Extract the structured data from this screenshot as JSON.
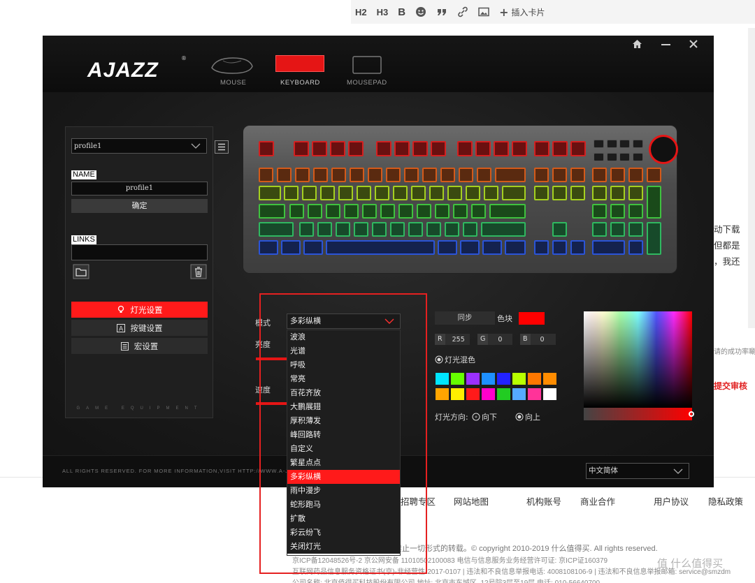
{
  "editor_toolbar": {
    "h2": "H2",
    "h3": "H3",
    "bold": "B",
    "insert_card": "插入卡片"
  },
  "background": {
    "side_lines": [
      "动下载",
      "但都是",
      "，我还"
    ],
    "side_notes": {
      "success": "请的成功率唰",
      "submit": "提交审核"
    },
    "footer_links": [
      "招聘专区",
      "网站地图",
      "机构账号",
      "商业合作",
      "用户协议",
      "隐私政策"
    ],
    "copyright": "禁止一切形式的转载。© copyright 2010-2019 什么值得买. All rights reserved.",
    "icp_line": "京ICP备12048526号-2  京公网安备 11010502100083 电信与信息服务业务经营许可证: 京ICP证160379",
    "drug_line": "互联网药品信息服务资格证书(京)-非经营性-2017-0107 | 违法和不良信息举报电话: 4008108106-9 | 违法和不良信息举报邮箱: service@smzdm",
    "company_line": "公司名称: 北京值得买科技股份有限公司 地址: 北京市东城区..12号院3层至19层 电话: 010-56640700",
    "watermark": "值 什么值得买"
  },
  "app": {
    "brand": "AJAZZ",
    "nav": [
      {
        "label": "MOUSE"
      },
      {
        "label": "KEYBOARD"
      },
      {
        "label": "MOUSEPAD"
      }
    ],
    "footer_text": "ALL RIGHTS RESERVED. FOR MORE INFORMATION,VISIT HTTP://WWW.A-J",
    "language": "中文简体",
    "left_panel": {
      "profile_select": "profile1",
      "name_label": "NAME",
      "name_value": "profile1",
      "confirm": "确定",
      "links_label": "LINKS",
      "menu": [
        {
          "label": "灯光设置",
          "active": true,
          "icon": "bulb-icon"
        },
        {
          "label": "按键设置",
          "active": false,
          "icon": "key-icon"
        },
        {
          "label": "宏设置",
          "active": false,
          "icon": "macro-icon"
        }
      ],
      "tagline": "GAME EQUIPMENT"
    },
    "lighting": {
      "mode_label": "模式",
      "mode_value": "多彩纵横",
      "brightness_label": "亮度",
      "speed_label": "速度",
      "sync": "同步",
      "color_block_label": "色块",
      "current_color": "#ff0000",
      "r_label": "R",
      "r_value": "255",
      "g_label": "G",
      "g_value": "0",
      "b_label": "B",
      "b_value": "0",
      "mix_label": "灯光混色",
      "direction_label": "灯光方向:",
      "dir_down": "向下",
      "dir_up": "向上",
      "palette": [
        "#00e5ff",
        "#66ff00",
        "#9b30ff",
        "#1e90ff",
        "#2222ff",
        "#b8ff00",
        "#ff7700",
        "#ff8c00",
        "#ffa500",
        "#ffee00",
        "#ff1a1a",
        "#ff00cc",
        "#22cc22",
        "#55aaff",
        "#ff3399",
        "#ffffff"
      ],
      "options": [
        "波浪",
        "光谱",
        "呼吸",
        "常亮",
        "百花齐放",
        "大鹏展翅",
        "厚积薄发",
        "峰回路转",
        "自定义",
        "繁星点点",
        "多彩纵横",
        "雨中漫步",
        "蛇形跑马",
        "扩散",
        "彩云纷飞",
        "关闭灯光"
      ],
      "selected_option": "多彩纵横"
    }
  }
}
